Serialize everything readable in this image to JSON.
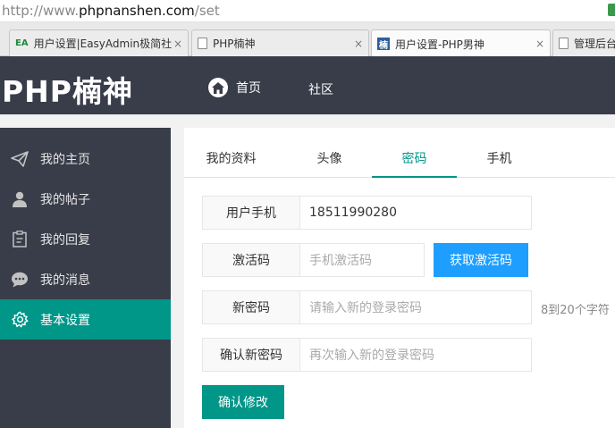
{
  "browser": {
    "url_proto": "http://www.",
    "url_host": "phpnanshen.com",
    "url_path": "/set",
    "tabs": [
      {
        "title": "用户设置|EasyAdmin极简社",
        "favicon": "ea-icon",
        "favicon_text": "EA"
      },
      {
        "title": "PHP楠神",
        "favicon": "doc-icon"
      },
      {
        "title": "用户设置-PHP男神",
        "favicon": "nan-icon",
        "favicon_text": "楠"
      },
      {
        "title": "管理后台",
        "favicon": "doc-icon"
      }
    ],
    "close_glyph": "×"
  },
  "header": {
    "logo": "PHP楠神",
    "nav": [
      "首页",
      "社区"
    ]
  },
  "sidebar": {
    "items": [
      {
        "label": "我的主页",
        "icon": "paper-plane-icon"
      },
      {
        "label": "我的帖子",
        "icon": "user-icon"
      },
      {
        "label": "我的回复",
        "icon": "clipboard-icon"
      },
      {
        "label": "我的消息",
        "icon": "chat-icon"
      },
      {
        "label": "基本设置",
        "icon": "gear-icon",
        "active": true
      }
    ]
  },
  "main": {
    "tabs": [
      "我的资料",
      "头像",
      "密码",
      "手机"
    ],
    "active_tab": "密码",
    "form": {
      "phone_label": "用户手机",
      "phone_value": "18511990280",
      "code_label": "激活码",
      "code_placeholder": "手机激活码",
      "get_code_button": "获取激活码",
      "new_pwd_label": "新密码",
      "new_pwd_placeholder": "请输入新的登录密码",
      "new_pwd_hint": "8到20个字符",
      "confirm_pwd_label": "确认新密码",
      "confirm_pwd_placeholder": "再次输入新的登录密码",
      "submit_button": "确认修改"
    }
  },
  "colors": {
    "header_bg": "#393d49",
    "accent": "#009688",
    "blue_button": "#1e9fff"
  }
}
